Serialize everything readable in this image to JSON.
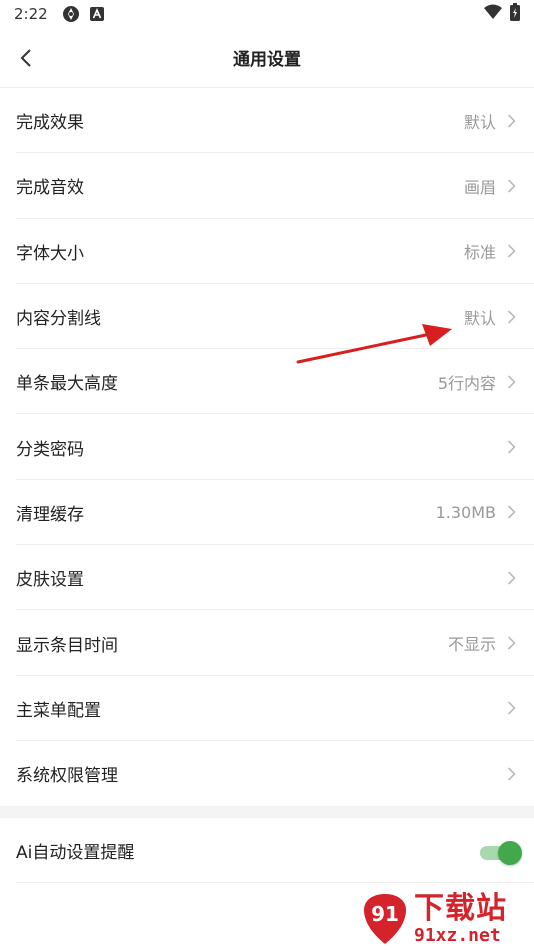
{
  "status_bar": {
    "time": "2:22",
    "icons": [
      "sync-icon",
      "a-badge-icon",
      "wifi-icon",
      "battery-charging-icon"
    ]
  },
  "header": {
    "title": "通用设置",
    "back_icon": "chevron-left-icon"
  },
  "settings": [
    {
      "label": "完成效果",
      "value": "默认"
    },
    {
      "label": "完成音效",
      "value": "画眉"
    },
    {
      "label": "字体大小",
      "value": "标准"
    },
    {
      "label": "内容分割线",
      "value": "默认"
    },
    {
      "label": "单条最大高度",
      "value": "5行内容"
    },
    {
      "label": "分类密码",
      "value": ""
    },
    {
      "label": "清理缓存",
      "value": "1.30MB"
    },
    {
      "label": "皮肤设置",
      "value": ""
    },
    {
      "label": "显示条目时间",
      "value": "不显示"
    },
    {
      "label": "主菜单配置",
      "value": ""
    },
    {
      "label": "系统权限管理",
      "value": ""
    }
  ],
  "toggle_setting": {
    "label": "Ai自动设置提醒",
    "enabled": true
  },
  "colors": {
    "accent_green": "#43a84c",
    "annotation_red": "#d81e1e",
    "watermark_red": "#d4232b"
  },
  "watermark": {
    "logo_text": "91",
    "title": "下载站",
    "url": "91xz.net"
  }
}
